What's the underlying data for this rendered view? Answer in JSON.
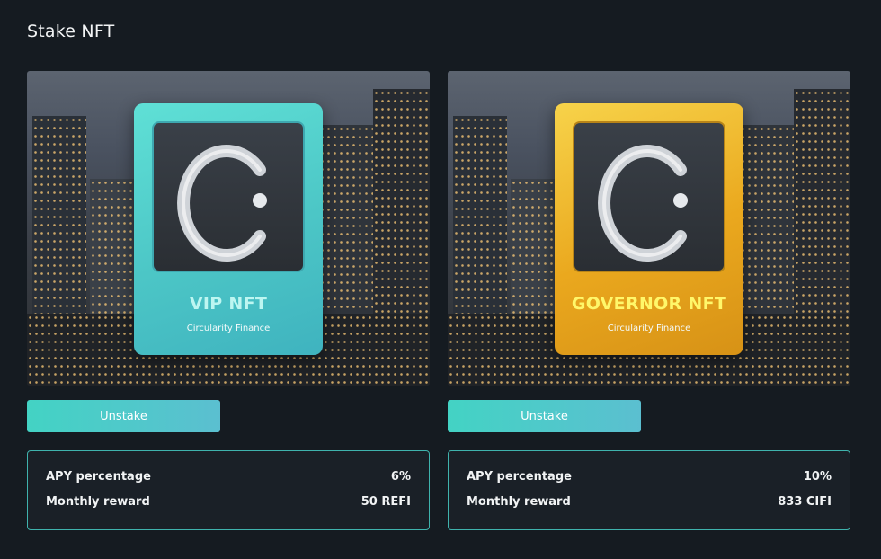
{
  "page": {
    "title": "Stake NFT"
  },
  "cards": [
    {
      "nft_name": "VIP NFT",
      "nft_subtitle": "Circularity Finance",
      "button_label": "Unstake",
      "stats": [
        {
          "label": "APY percentage",
          "value": "6%"
        },
        {
          "label": "Monthly reward",
          "value": "50 REFI"
        }
      ]
    },
    {
      "nft_name": "GOVERNOR NFT",
      "nft_subtitle": "Circularity Finance",
      "button_label": "Unstake",
      "stats": [
        {
          "label": "APY percentage",
          "value": "10%"
        },
        {
          "label": "Monthly reward",
          "value": "833 CIFI"
        }
      ]
    }
  ],
  "colors": {
    "background": "#151b21",
    "accent_teal": "#43d3c4",
    "vip_card": "#4cc6c6",
    "governor_card": "#eaa81e"
  }
}
